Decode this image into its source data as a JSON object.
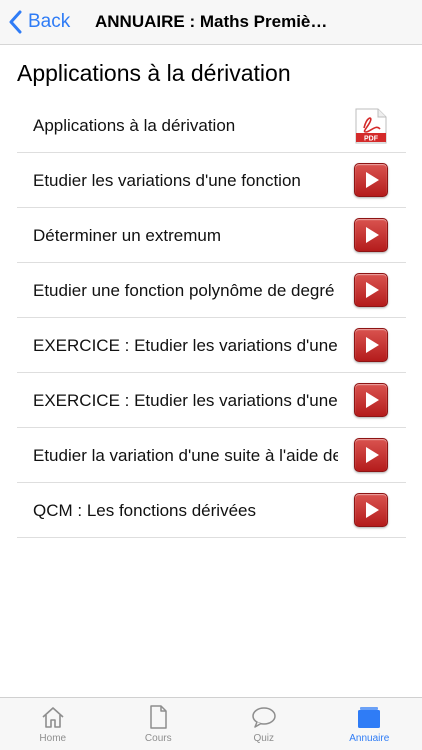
{
  "header": {
    "back_label": "Back",
    "title": "ANNUAIRE : Maths Premièr..."
  },
  "section": {
    "title": "Applications à la dérivation"
  },
  "items": [
    {
      "label": "Applications à la dérivation",
      "icon": "pdf-icon",
      "pdf_text": "PDF"
    },
    {
      "label": "Etudier les variations d'une fonction",
      "icon": "play-icon"
    },
    {
      "label": "Déterminer un extremum",
      "icon": "play-icon"
    },
    {
      "label": "Etudier une fonction polynôme de degré",
      "icon": "play-icon"
    },
    {
      "label": "EXERCICE : Etudier les variations d'une fonction",
      "icon": "play-icon"
    },
    {
      "label": "EXERCICE : Etudier les variations d'une fonction",
      "icon": "play-icon"
    },
    {
      "label": "Etudier la variation d'une suite à l'aide de",
      "icon": "play-icon"
    },
    {
      "label": "QCM : Les fonctions dérivées",
      "icon": "play-icon"
    }
  ],
  "tabs": [
    {
      "label": "Home",
      "icon": "home-icon",
      "active": false
    },
    {
      "label": "Cours",
      "icon": "document-icon",
      "active": false
    },
    {
      "label": "Quiz",
      "icon": "chat-bubble-icon",
      "active": false
    },
    {
      "label": "Annuaire",
      "icon": "folder-icon",
      "active": true
    }
  ],
  "colors": {
    "accent": "#2f7cf6",
    "play_red": "#c0262a",
    "pdf_red": "#d42a2a"
  }
}
